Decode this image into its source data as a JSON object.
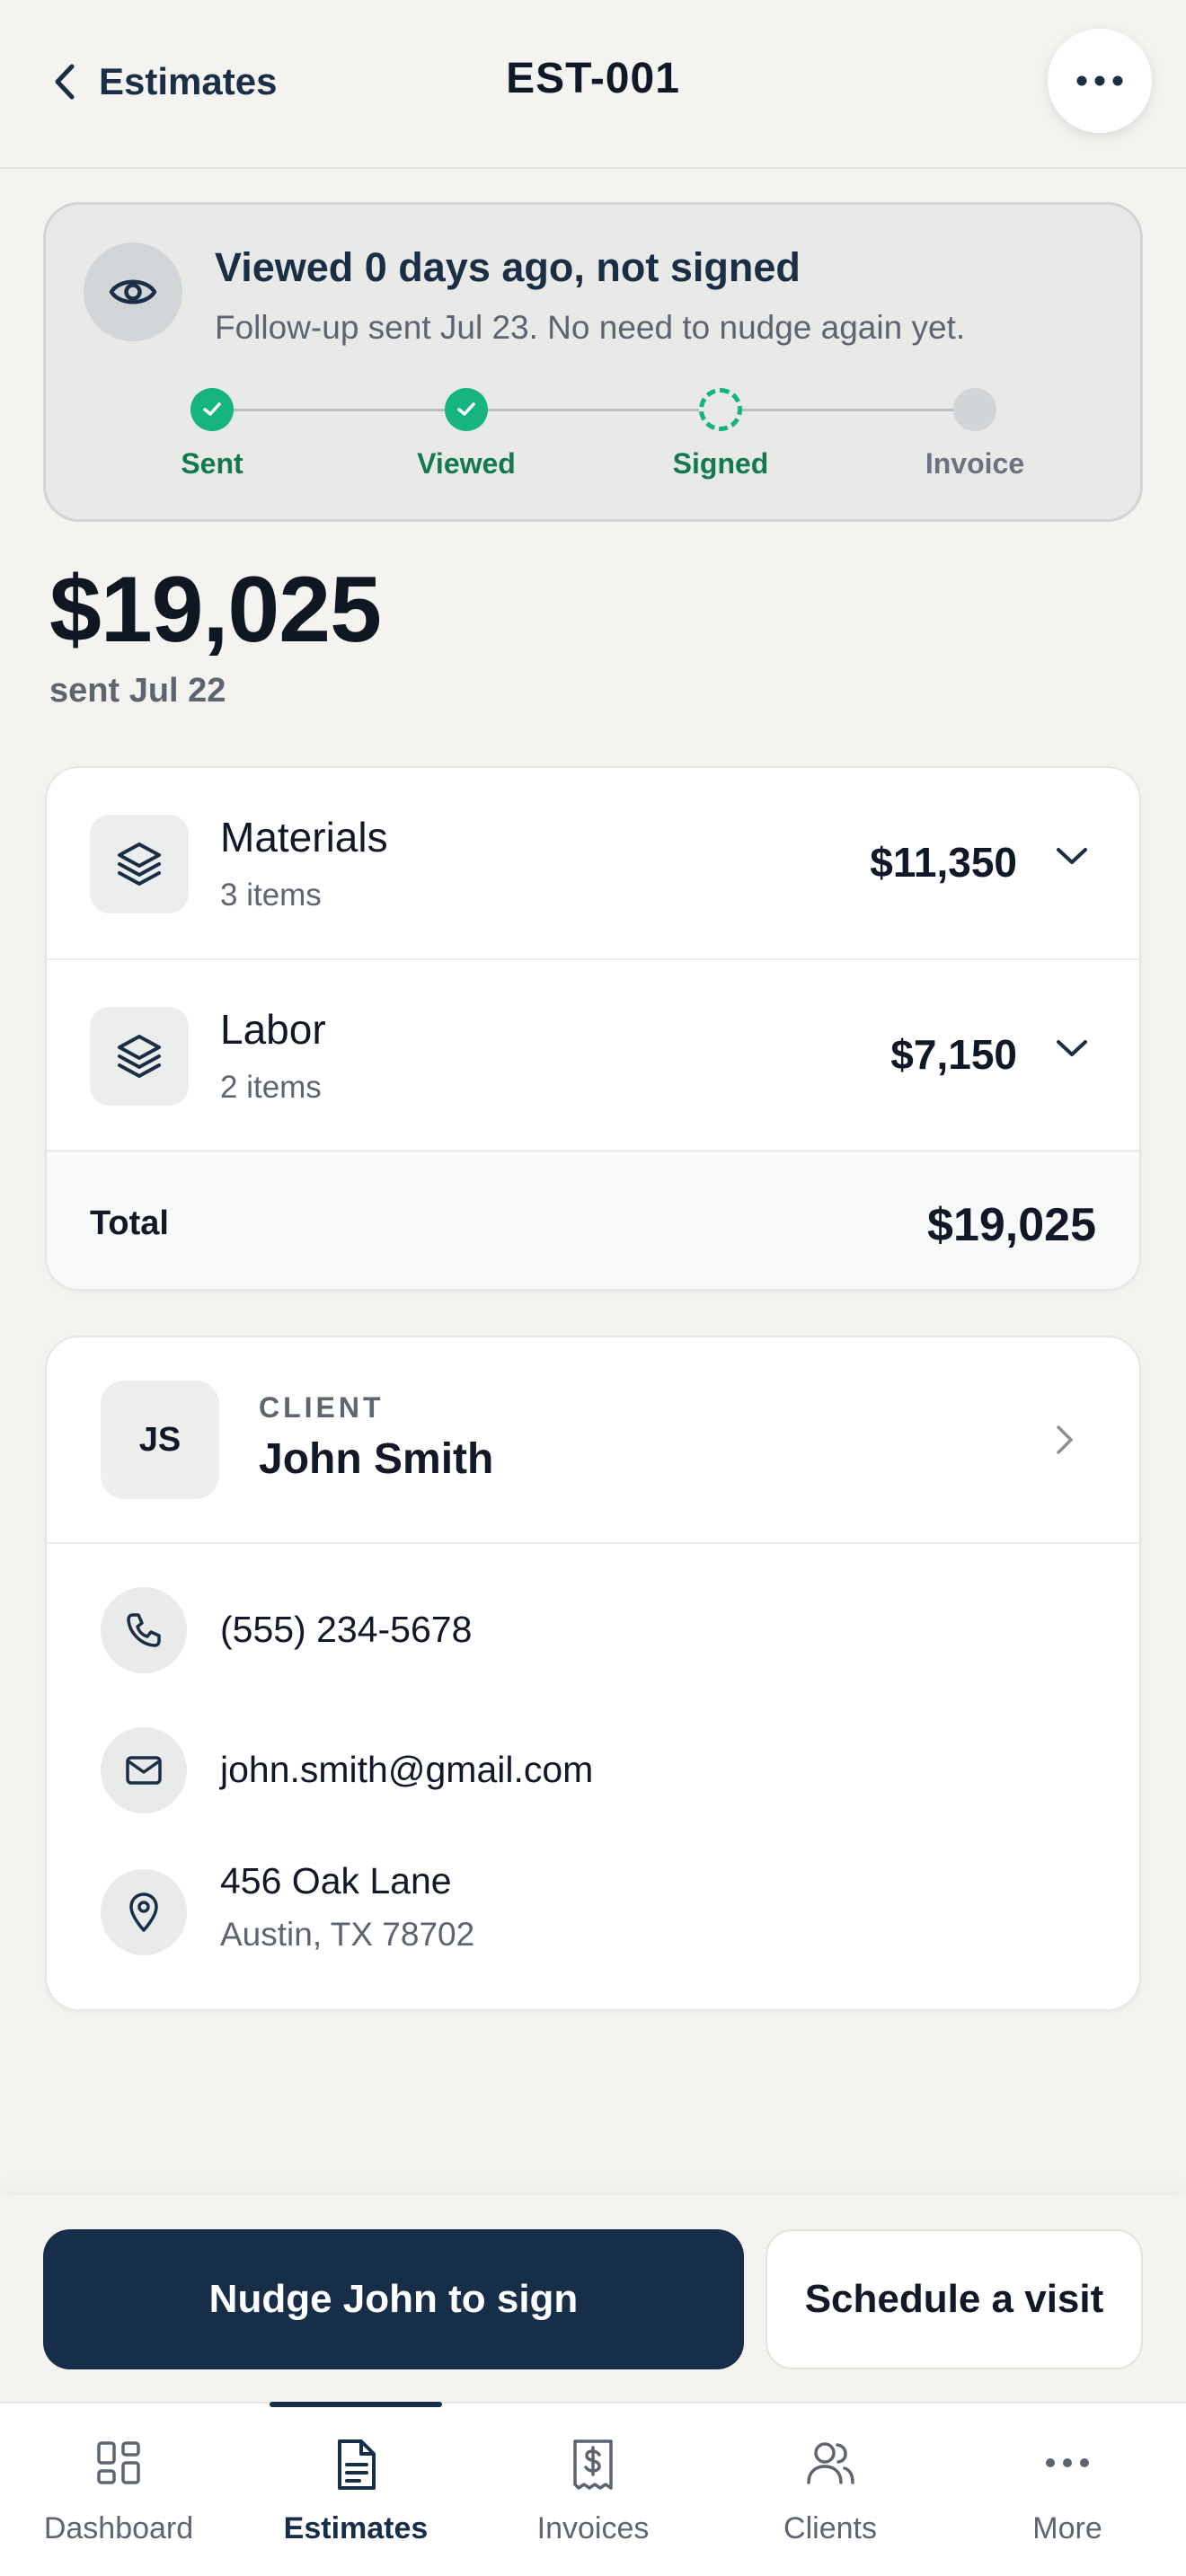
{
  "header": {
    "back_label": "Estimates",
    "title": "EST-001"
  },
  "status": {
    "title": "Viewed 0 days ago, not signed",
    "subtitle": "Follow-up sent Jul 23. No need to nudge again yet.",
    "steps": [
      {
        "label": "Sent",
        "state": "done"
      },
      {
        "label": "Viewed",
        "state": "done"
      },
      {
        "label": "Signed",
        "state": "pending"
      },
      {
        "label": "Invoice",
        "state": "future"
      }
    ],
    "accent_color": "#16b47f"
  },
  "estimate": {
    "amount": "$19,025",
    "sent": "sent Jul 22"
  },
  "line_items": [
    {
      "name": "Materials",
      "count": "3 items",
      "amount": "$11,350",
      "icon": "layers-icon"
    },
    {
      "name": "Labor",
      "count": "2 items",
      "amount": "$7,150",
      "icon": "layers-icon"
    }
  ],
  "totals": {
    "label": "Total",
    "amount": "$19,025"
  },
  "client": {
    "kicker": "CLIENT",
    "initials": "JS",
    "name": "John Smith",
    "phone": "(555) 234-5678",
    "email": "john.smith@gmail.com",
    "address_line1": "456 Oak Lane",
    "address_line2": "Austin, TX 78702"
  },
  "actions": {
    "primary": "Nudge John to sign",
    "secondary": "Schedule a visit",
    "primary_color": "#172e49"
  },
  "tabs": [
    {
      "label": "Dashboard",
      "icon": "grid-icon"
    },
    {
      "label": "Estimates",
      "icon": "document-icon",
      "active": true
    },
    {
      "label": "Invoices",
      "icon": "receipt-dollar-icon"
    },
    {
      "label": "Clients",
      "icon": "users-icon"
    },
    {
      "label": "More",
      "icon": "more-dots-icon"
    }
  ]
}
